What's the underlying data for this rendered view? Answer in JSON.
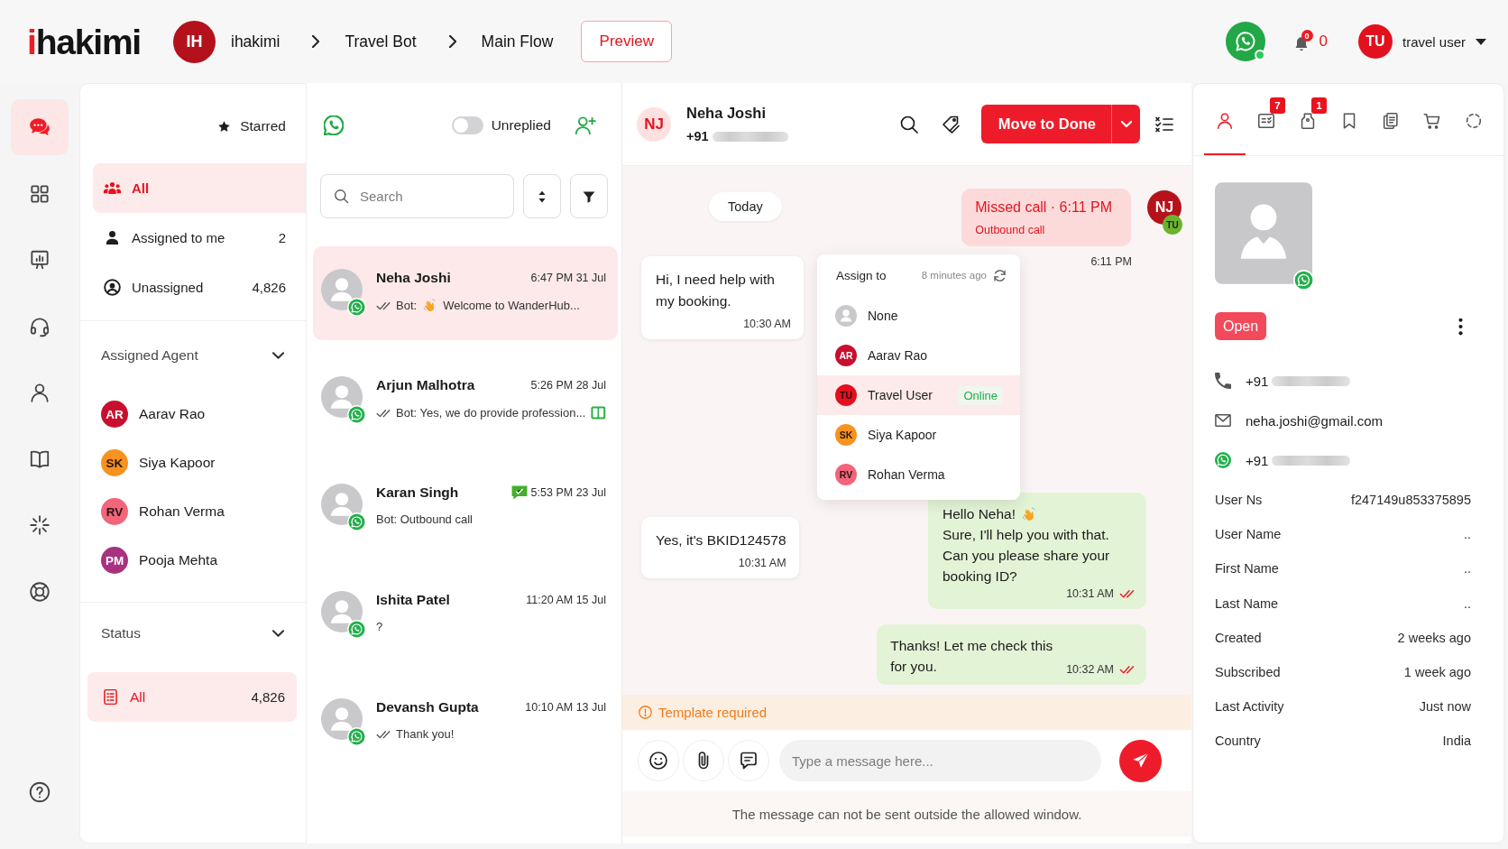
{
  "header": {
    "logo": "ihakimi",
    "workspace": {
      "initials": "IH",
      "name": "ihakimi"
    },
    "breadcrumb": [
      "Travel Bot",
      "Main Flow"
    ],
    "preview_button": "Preview",
    "notifications": {
      "badge": "0",
      "count": "0"
    },
    "user": {
      "initials": "TU",
      "name": "travel user"
    }
  },
  "nav_rail": [
    {
      "selected": true
    },
    {
      "selected": false
    },
    {
      "selected": false
    },
    {
      "selected": false
    },
    {
      "selected": false
    },
    {
      "selected": false
    },
    {
      "selected": false
    },
    {
      "selected": false
    }
  ],
  "filters": {
    "starred": "Starred",
    "views": [
      {
        "label": "All",
        "selected": true
      },
      {
        "label": "Assigned to me",
        "count": "2",
        "selected": false
      },
      {
        "label": "Unassigned",
        "count": "4,826",
        "selected": false
      }
    ],
    "agents": {
      "title": "Assigned Agent",
      "expanded": true,
      "items": [
        {
          "initials": "AR",
          "name": "Aarav Rao",
          "color": "#c8102e"
        },
        {
          "initials": "SK",
          "name": "Siya Kapoor",
          "color": "#f7931e"
        },
        {
          "initials": "RV",
          "name": "Rohan Verma",
          "color": "#f2657a"
        },
        {
          "initials": "PM",
          "name": "Pooja Mehta",
          "color": "#a8327f"
        }
      ]
    },
    "status": {
      "title": "Status",
      "expanded": true,
      "items": [
        {
          "label": "All",
          "count": "4,826",
          "selected": true
        }
      ]
    }
  },
  "conversations": {
    "unreplied": {
      "label": "Unreplied",
      "on": false
    },
    "search": {
      "placeholder": "Search"
    },
    "items": [
      {
        "name": "Neha Joshi",
        "time": "6:47 PM 31 Jul",
        "ticks": true,
        "preview": [
          {
            "kind": "text",
            "text": "Bot:"
          },
          {
            "kind": "emoji"
          },
          {
            "kind": "text",
            "text": "Welcome to WanderHub..."
          }
        ],
        "time_icon": false,
        "end_icon": false,
        "selected": true
      },
      {
        "name": "Arjun Malhotra",
        "time": "5:26 PM 28 Jul",
        "ticks": true,
        "preview": [
          {
            "kind": "text",
            "text": "Bot: Yes, we do provide profession..."
          }
        ],
        "time_icon": false,
        "end_icon": true,
        "selected": false
      },
      {
        "name": "Karan Singh",
        "time": "5:53 PM 23 Jul",
        "ticks": false,
        "preview": [
          {
            "kind": "text",
            "text": "Bot: Outbound call"
          }
        ],
        "time_icon": true,
        "end_icon": false,
        "selected": false
      },
      {
        "name": "Ishita Patel",
        "time": "11:20 AM 15 Jul",
        "ticks": false,
        "preview": [
          {
            "kind": "text",
            "text": "?"
          }
        ],
        "time_icon": false,
        "end_icon": false,
        "selected": false
      },
      {
        "name": "Devansh Gupta",
        "time": "10:10 AM 13 Jul",
        "ticks": true,
        "preview": [
          {
            "kind": "text",
            "text": "Thank you!"
          }
        ],
        "time_icon": false,
        "end_icon": false,
        "selected": false
      }
    ]
  },
  "chat": {
    "contact": {
      "initials": "NJ",
      "name": "Neha Joshi",
      "phone": "+91"
    },
    "primary_action": "Move to Done",
    "date": "Today",
    "messages": [
      {
        "outgoing": true,
        "kind": "call",
        "title": "Missed call · 6:11 PM",
        "subtitle": "Outbound call",
        "stamp": "6:11 PM",
        "sender": "NJ",
        "agent": "TU"
      },
      {
        "outgoing": false,
        "kind": "text",
        "text": "Hi, I need help with my booking.",
        "time": "10:30 AM"
      },
      {
        "outgoing": false,
        "kind": "text",
        "text": "Yes, it's BKID124578",
        "time": "10:31 AM"
      },
      {
        "outgoing": true,
        "kind": "text",
        "greeting": "Hello Neha!",
        "emoji": true,
        "text": "Sure, I'll help you with that.\nCan you please share your booking ID?",
        "time": "10:31 AM",
        "read": true
      },
      {
        "outgoing": true,
        "kind": "text",
        "text": "Thanks! Let me check this for you.",
        "time": "10:32 AM",
        "read": true
      }
    ],
    "assign_menu": {
      "title": "Assign to",
      "updated": "8 minutes ago",
      "options": [
        {
          "kind": "none",
          "name": "None",
          "selected": false
        },
        {
          "kind": "agent",
          "initials": "AR",
          "name": "Aarav Rao",
          "color": "#c8102e",
          "selected": false
        },
        {
          "kind": "agent",
          "initials": "TU",
          "name": "Travel User",
          "color": "#e3101e",
          "status": "Online",
          "selected": true
        },
        {
          "kind": "agent",
          "initials": "SK",
          "name": "Siya Kapoor",
          "color": "#f7931e",
          "selected": false
        },
        {
          "kind": "agent",
          "initials": "RV",
          "name": "Rohan Verma",
          "color": "#f2657a",
          "selected": false
        }
      ]
    },
    "template_notice": "Template required",
    "composer": {
      "placeholder": "Type a message here..."
    },
    "window_note": "The message can not be sent outside the allowed window."
  },
  "contact_panel": {
    "tabs": [
      {
        "selected": true
      },
      {
        "badge": "7",
        "selected": false
      },
      {
        "badge": "1",
        "selected": false
      },
      {
        "selected": false
      },
      {
        "selected": false
      },
      {
        "selected": false
      },
      {
        "selected": false
      }
    ],
    "status": "Open",
    "phone": "+91",
    "email": "neha.joshi@gmail.com",
    "whatsapp": "+91",
    "fields": [
      {
        "label": "User Ns",
        "value": "f247149u853375895"
      },
      {
        "label": "User Name",
        "value": ".."
      },
      {
        "label": "First Name",
        "value": ".."
      },
      {
        "label": "Last Name",
        "value": ".."
      },
      {
        "label": "Created",
        "value": "2 weeks ago"
      },
      {
        "label": "Subscribed",
        "value": "1 week ago"
      },
      {
        "label": "Last Activity",
        "value": "Just now"
      },
      {
        "label": "Country",
        "value": "India"
      }
    ]
  }
}
